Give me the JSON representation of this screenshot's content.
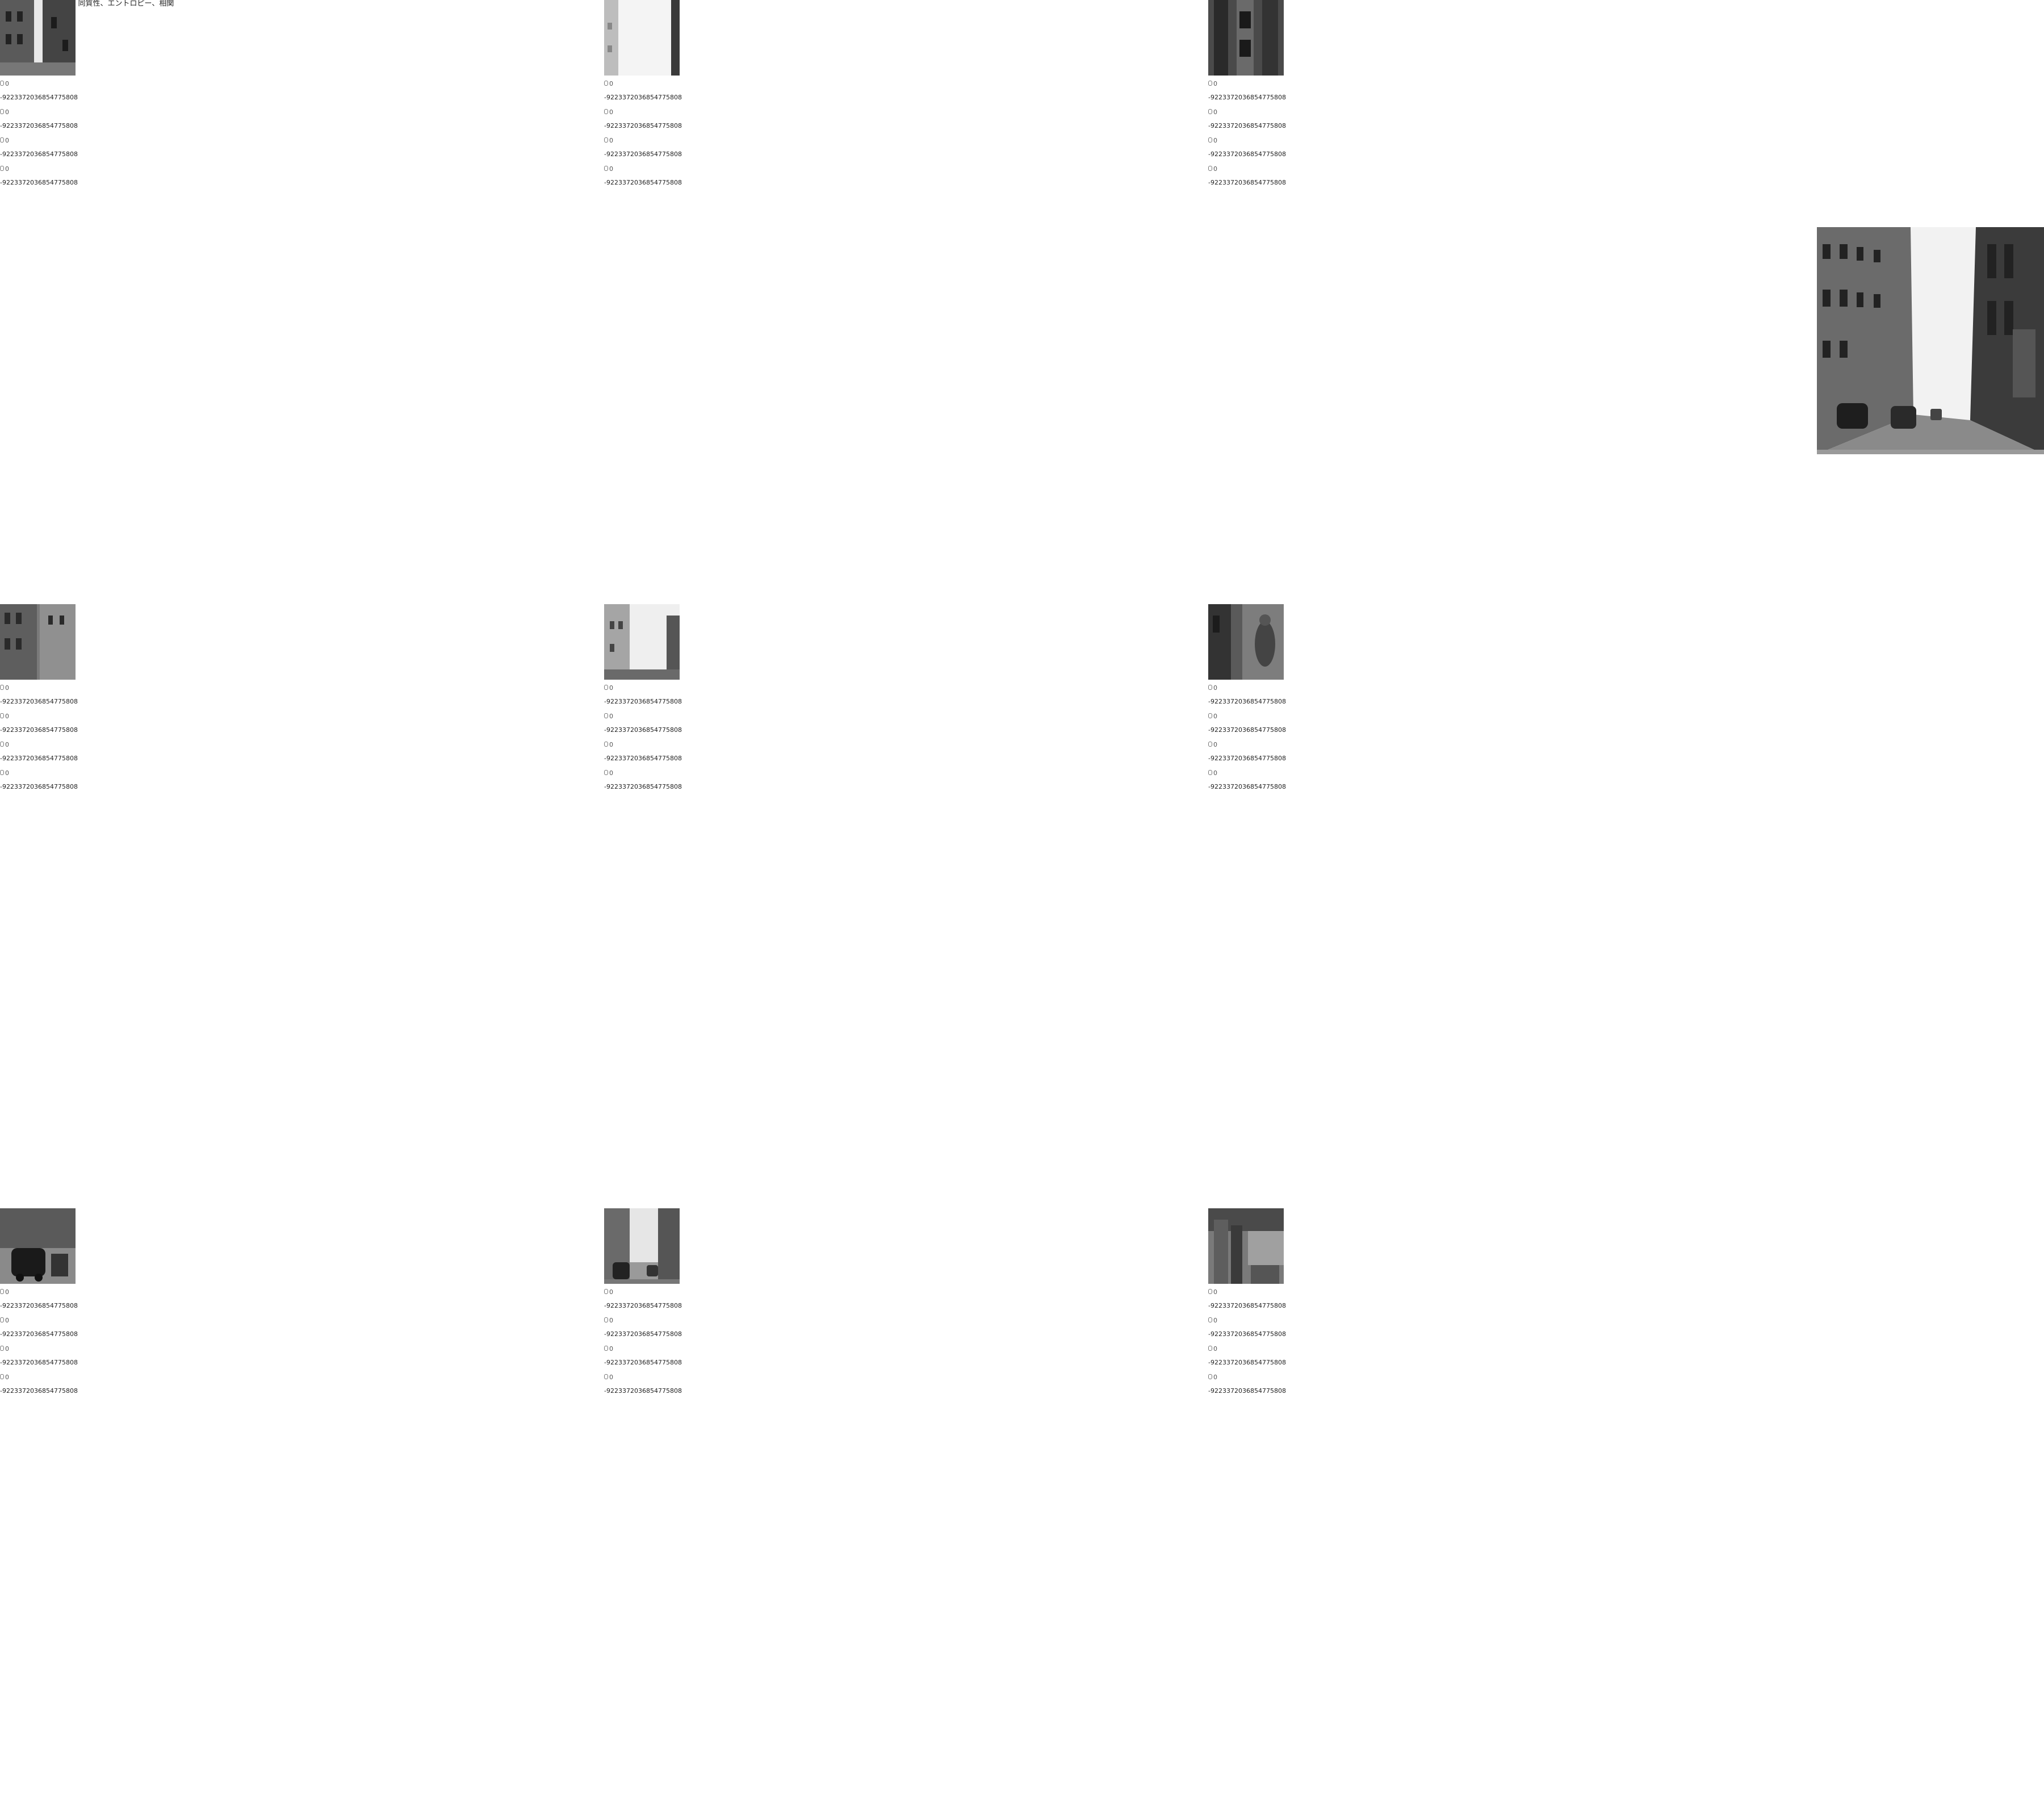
{
  "page": {
    "title": "コントラスト、同質性、エントロピー、相関",
    "preview_alt": "Full street image"
  },
  "grid": {
    "tiles": [
      {
        "stats": [
          {
            "zero": "0",
            "value": "-9223372036854775808"
          },
          {
            "zero": "0",
            "value": "-9223372036854775808"
          },
          {
            "zero": "0",
            "value": "-9223372036854775808"
          },
          {
            "zero": "0",
            "value": "-9223372036854775808"
          }
        ]
      },
      {
        "stats": [
          {
            "zero": "0",
            "value": "-9223372036854775808"
          },
          {
            "zero": "0",
            "value": "-9223372036854775808"
          },
          {
            "zero": "0",
            "value": "-9223372036854775808"
          },
          {
            "zero": "0",
            "value": "-9223372036854775808"
          }
        ]
      },
      {
        "stats": [
          {
            "zero": "0",
            "value": "-9223372036854775808"
          },
          {
            "zero": "0",
            "value": "-9223372036854775808"
          },
          {
            "zero": "0",
            "value": "-9223372036854775808"
          },
          {
            "zero": "0",
            "value": "-9223372036854775808"
          }
        ]
      },
      {
        "stats": [
          {
            "zero": "0",
            "value": "-9223372036854775808"
          },
          {
            "zero": "0",
            "value": "-9223372036854775808"
          },
          {
            "zero": "0",
            "value": "-9223372036854775808"
          },
          {
            "zero": "0",
            "value": "-9223372036854775808"
          }
        ]
      },
      {
        "stats": [
          {
            "zero": "0",
            "value": "-9223372036854775808"
          },
          {
            "zero": "0",
            "value": "-9223372036854775808"
          },
          {
            "zero": "0",
            "value": "-9223372036854775808"
          },
          {
            "zero": "0",
            "value": "-9223372036854775808"
          }
        ]
      },
      {
        "stats": [
          {
            "zero": "0",
            "value": "-9223372036854775808"
          },
          {
            "zero": "0",
            "value": "-9223372036854775808"
          },
          {
            "zero": "0",
            "value": "-9223372036854775808"
          },
          {
            "zero": "0",
            "value": "-9223372036854775808"
          }
        ]
      },
      {
        "stats": [
          {
            "zero": "0",
            "value": "-9223372036854775808"
          },
          {
            "zero": "0",
            "value": "-9223372036854775808"
          },
          {
            "zero": "0",
            "value": "-9223372036854775808"
          },
          {
            "zero": "0",
            "value": "-9223372036854775808"
          }
        ]
      },
      {
        "stats": [
          {
            "zero": "0",
            "value": "-9223372036854775808"
          },
          {
            "zero": "0",
            "value": "-9223372036854775808"
          },
          {
            "zero": "0",
            "value": "-9223372036854775808"
          },
          {
            "zero": "0",
            "value": "-9223372036854775808"
          }
        ]
      },
      {
        "stats": [
          {
            "zero": "0",
            "value": "-9223372036854775808"
          },
          {
            "zero": "0",
            "value": "-9223372036854775808"
          },
          {
            "zero": "0",
            "value": "-9223372036854775808"
          },
          {
            "zero": "0",
            "value": "-9223372036854775808"
          }
        ]
      }
    ]
  },
  "colors": {
    "text": "#222222",
    "background": "#ffffff",
    "photo_dark": "#2a2a2a",
    "photo_light": "#f2f2f2"
  }
}
